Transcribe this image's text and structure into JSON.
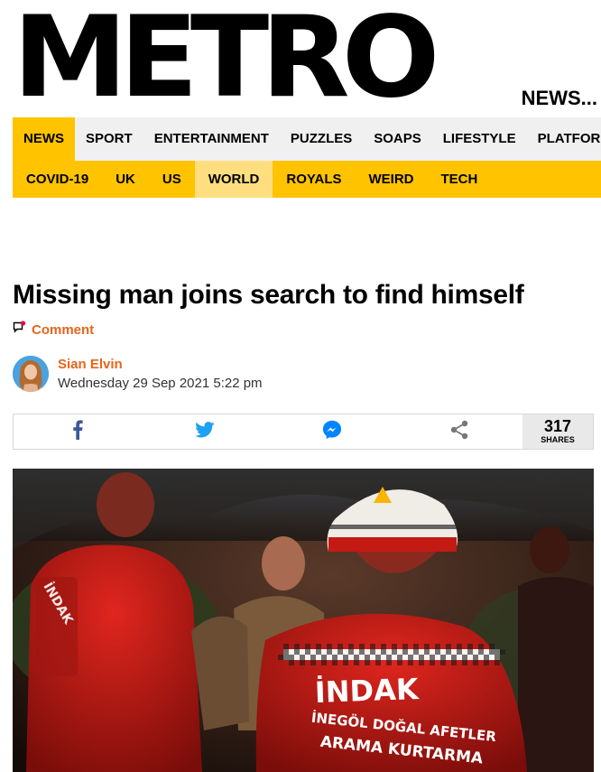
{
  "masthead": {
    "logo": "METRO",
    "section": "NEWS..."
  },
  "nav_primary": [
    "NEWS",
    "SPORT",
    "ENTERTAINMENT",
    "PUZZLES",
    "SOAPS",
    "LIFESTYLE",
    "PLATFORM"
  ],
  "nav_secondary": [
    "COVID-19",
    "UK",
    "US",
    "WORLD",
    "ROYALS",
    "WEIRD",
    "TECH"
  ],
  "article": {
    "headline": "Missing man joins search to find himself",
    "comment_label": "Comment",
    "author": "Sian Elvin",
    "date": "Wednesday 29 Sep 2021 5:22 pm"
  },
  "share": {
    "buttons": [
      "facebook-icon",
      "twitter-icon",
      "messenger-icon",
      "share-icon"
    ],
    "count": "317",
    "count_label": "SHARES"
  },
  "hero_image": {
    "vest_text_1": "İNDAK",
    "vest_text_2": "İNEGÖL DOĞAL AFETLER",
    "vest_text_3": "ARAMA KURTARMA"
  },
  "colors": {
    "accent_yellow": "#ffc300",
    "accent_orange": "#e8641b",
    "facebook": "#3b5998",
    "twitter": "#1da1f2",
    "messenger": "#0084ff"
  }
}
